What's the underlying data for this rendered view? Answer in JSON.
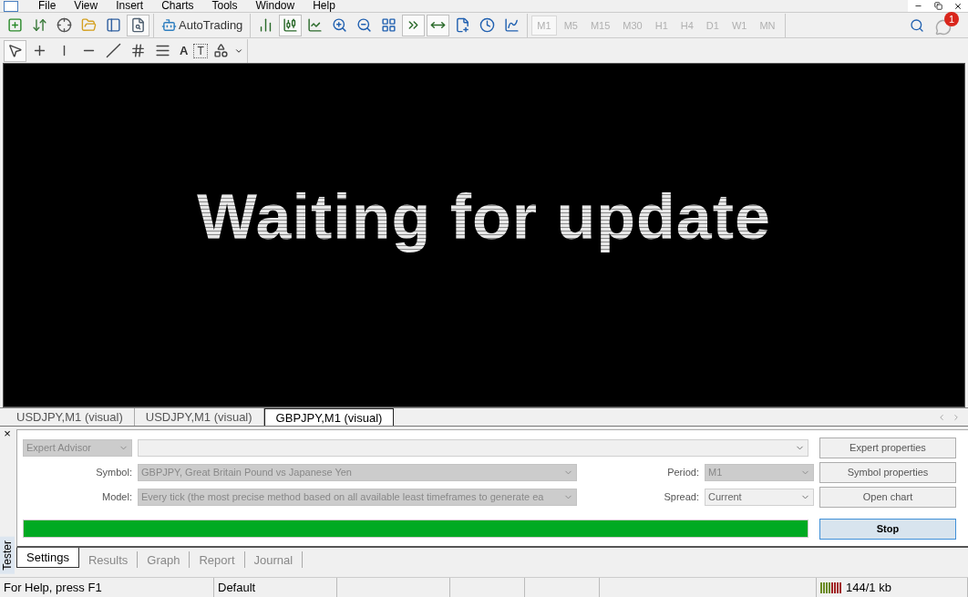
{
  "menu": [
    "File",
    "View",
    "Insert",
    "Charts",
    "Tools",
    "Window",
    "Help"
  ],
  "main_toolbar": {
    "buttons": [
      {
        "selected": false
      },
      {
        "selected": false
      },
      {
        "selected": false
      },
      {
        "selected": false
      },
      {
        "selected": false
      },
      {
        "selected": true
      }
    ],
    "autotrading": {
      "label": "AutoTrading",
      "selected": false
    },
    "chart_buttons": [
      {
        "selected": false
      },
      {
        "selected": true
      },
      {
        "selected": false
      },
      {
        "selected": false
      },
      {
        "selected": false
      },
      {
        "selected": false
      },
      {
        "selected": true
      },
      {
        "selected": true
      },
      {
        "selected": false
      },
      {
        "selected": false
      },
      {
        "selected": false
      }
    ]
  },
  "timeframes": [
    {
      "label": "M1",
      "selected": true
    },
    {
      "label": "M5",
      "selected": false
    },
    {
      "label": "M15",
      "selected": false
    },
    {
      "label": "M30",
      "selected": false
    },
    {
      "label": "H1",
      "selected": false
    },
    {
      "label": "H4",
      "selected": false
    },
    {
      "label": "D1",
      "selected": false
    },
    {
      "label": "W1",
      "selected": false
    },
    {
      "label": "MN",
      "selected": false
    }
  ],
  "notifications": {
    "badge": "1"
  },
  "drawing_toolbar": {
    "buttons": [
      {
        "selected": true
      },
      {
        "selected": false
      },
      {
        "selected": false
      },
      {
        "selected": false
      },
      {
        "selected": false
      },
      {
        "selected": false
      },
      {
        "selected": false
      }
    ],
    "text_tool": "A",
    "label_tool": "T"
  },
  "chart": {
    "message": "Waiting for update"
  },
  "chart_tabs": [
    {
      "label": "USDJPY,M1 (visual)",
      "selected": false
    },
    {
      "label": "USDJPY,M1 (visual)",
      "selected": false
    },
    {
      "label": "GBPJPY,M1 (visual)",
      "selected": true
    }
  ],
  "tester": {
    "close": "×",
    "title": "Tester",
    "program_type": {
      "value": "Expert Advisor",
      "disabled": true
    },
    "symbol": {
      "label": "Symbol:",
      "value": "GBPJPY, Great Britain Pound vs Japanese Yen",
      "disabled": true
    },
    "model": {
      "label": "Model:",
      "value": "Every tick (the most precise method based on all available least timeframes to generate ea",
      "disabled": true
    },
    "period": {
      "label": "Period:",
      "value": "M1",
      "disabled": true
    },
    "spread": {
      "label": "Spread:",
      "value": "Current",
      "disabled": false
    },
    "buttons": [
      {
        "label": "Expert properties"
      },
      {
        "label": "Symbol properties"
      },
      {
        "label": "Open chart"
      }
    ],
    "progress": {
      "level": 1
    },
    "stop_button": {
      "label": "Stop"
    },
    "tabs": [
      {
        "label": "Settings",
        "selected": true
      },
      {
        "label": "Results",
        "selected": false
      },
      {
        "label": "Graph",
        "selected": false
      },
      {
        "label": "Report",
        "selected": false
      },
      {
        "label": "Journal",
        "selected": false
      }
    ]
  },
  "status_bar": {
    "help": "For Help, press F1",
    "profile": "Default",
    "traffic": "144/1 kb"
  }
}
